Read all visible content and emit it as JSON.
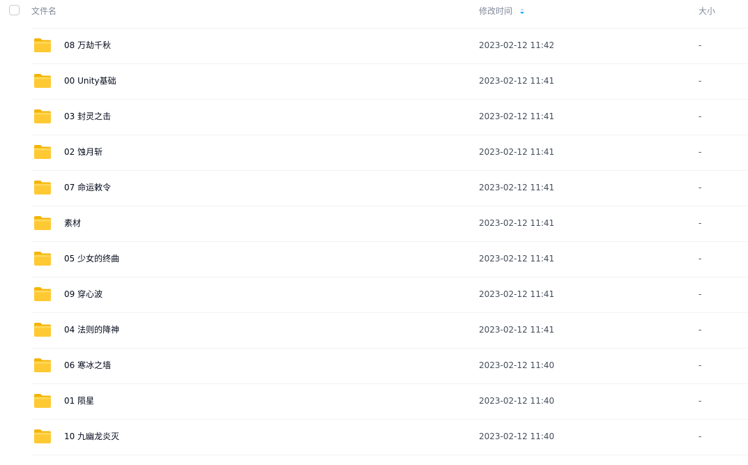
{
  "header": {
    "name_label": "文件名",
    "time_label": "修改时间",
    "size_label": "大小",
    "sort_icon": "sort-desc-icon",
    "sort_color": "#06a7ff"
  },
  "folder_icon": "folder-icon",
  "files": [
    {
      "name": "08 万劫千秋",
      "time": "2023-02-12 11:42",
      "size": "-"
    },
    {
      "name": "00 Unity基础",
      "time": "2023-02-12 11:41",
      "size": "-"
    },
    {
      "name": "03 封灵之击",
      "time": "2023-02-12 11:41",
      "size": "-"
    },
    {
      "name": "02 蚀月斩",
      "time": "2023-02-12 11:41",
      "size": "-"
    },
    {
      "name": "07 命运敕令",
      "time": "2023-02-12 11:41",
      "size": "-"
    },
    {
      "name": "素材",
      "time": "2023-02-12 11:41",
      "size": "-"
    },
    {
      "name": "05 少女的终曲",
      "time": "2023-02-12 11:41",
      "size": "-"
    },
    {
      "name": "09 穿心波",
      "time": "2023-02-12 11:41",
      "size": "-"
    },
    {
      "name": "04 法则的降神",
      "time": "2023-02-12 11:41",
      "size": "-"
    },
    {
      "name": "06 寒冰之墙",
      "time": "2023-02-12 11:40",
      "size": "-"
    },
    {
      "name": "01 陨星",
      "time": "2023-02-12 11:40",
      "size": "-"
    },
    {
      "name": "10 九幽龙炎灭",
      "time": "2023-02-12 11:40",
      "size": "-"
    }
  ]
}
